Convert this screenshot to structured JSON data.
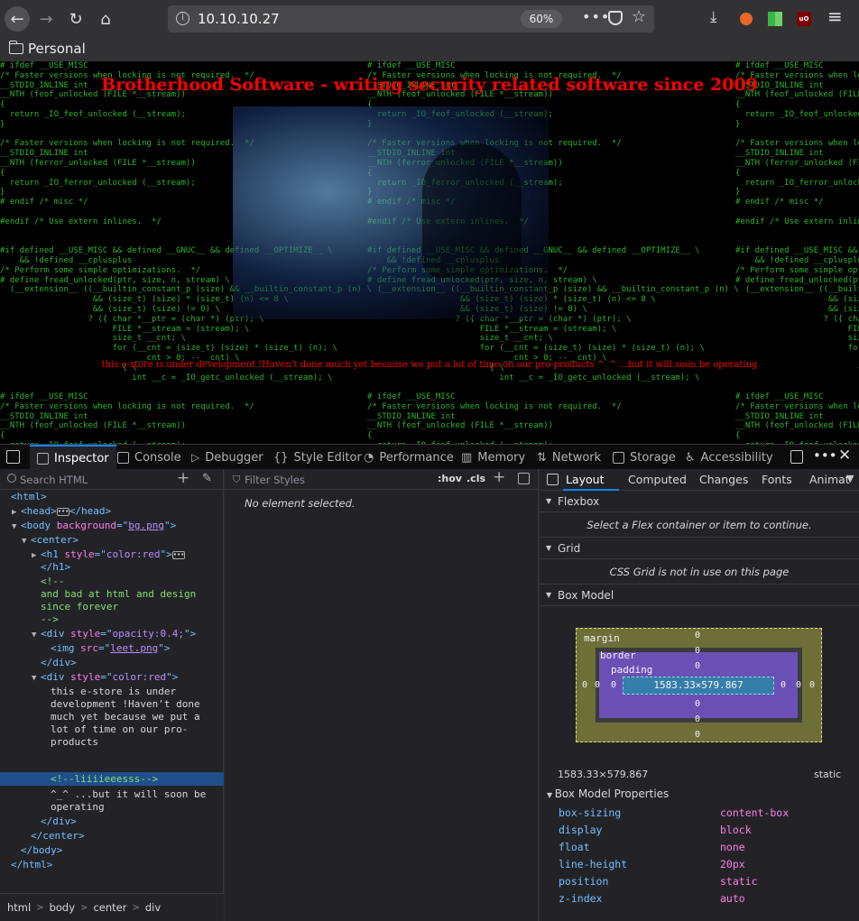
{
  "browser": {
    "url": "10.10.10.27",
    "zoom": "60%",
    "bookmark_folder": "Personal",
    "ext_badge": "uO"
  },
  "page": {
    "heading": "Brotherhood Software - writing security related software since 2009",
    "message": "this e-store is under development !Haven't done much yet because we put a lot of time on our pro-products ^_^ ...but it will soon be operating",
    "code_lines": [
      "# ifdef __USE_MISC",
      "/* Faster versions when locking is not required.  */",
      "__STDIO_INLINE int",
      "__NTH (feof_unlocked (FILE *__stream))",
      "{",
      "  return _IO_feof_unlocked (__stream);",
      "}",
      "",
      "/* Faster versions when locking is not required.  */",
      "__STDIO_INLINE int",
      "__NTH (ferror_unlocked (FILE *__stream))",
      "{",
      "  return _IO_ferror_unlocked (__stream);",
      "}",
      "# endif /* misc */",
      "",
      "#endif /* Use extern inlines.  */",
      "",
      "",
      "#if defined __USE_MISC && defined __GNUC__ && defined __OPTIMIZE__ \\",
      "    && !defined __cplusplus",
      "/* Perform some simple optimizations.  */",
      "# define fread_unlocked(ptr, size, n, stream) \\",
      "  (__extension__ ((__builtin_constant_p (size) && __builtin_constant_p (n) \\",
      "                   && (size_t) (size) * (size_t) (n) <= 8 \\",
      "                   && (size_t) (size) != 0) \\",
      "                  ? ({ char *__ptr = (char *) (ptr); \\",
      "                       FILE *__stream = (stream); \\",
      "                       size_t __cnt; \\",
      "                       for (__cnt = (size_t) (size) * (size_t) (n); \\",
      "                            __cnt > 0; --__cnt) \\",
      "                         { \\",
      "                           int __c = _IO_getc_unlocked (__stream); \\",
      "",
      "# ifdef __USE_MISC",
      "/* Faster versions when locking is not required.  */",
      "__STDIO_INLINE int",
      "__NTH (feof_unlocked (FILE *__stream))",
      "{",
      "  return _IO_feof_unlocked (__stream);"
    ]
  },
  "devtools": {
    "tabs": [
      "Inspector",
      "Console",
      "Debugger",
      "Style Editor",
      "Performance",
      "Memory",
      "Network",
      "Storage",
      "Accessibility"
    ],
    "search_placeholder": "Search HTML",
    "filter_placeholder": "Filter Styles",
    "hov": ":hov",
    "cls": ".cls",
    "no_element": "No element selected.",
    "markup": {
      "html_open": "<html>",
      "head_open": "<head>",
      "head_close": "</head>",
      "body_open": "<body ",
      "body_attr": "background",
      "body_val": "bg.png",
      "center_open": "<center>",
      "h1_open": "<h1 ",
      "h1_attr": "style",
      "h1_val": "color:red",
      "h1_close": "</h1>",
      "comment1_l1": "<!--",
      "comment1_l2": "and bad at html and design",
      "comment1_l3": "since forever",
      "comment1_l4": "-->",
      "div1_open": "<div ",
      "div1_attr": "style",
      "div1_val": "opacity:0.4;",
      "img_open": "<img ",
      "img_attr": "src",
      "img_val": "leet.png",
      "div_close": "</div>",
      "div2_open": "<div ",
      "div2_attr": "style",
      "div2_val": "color:red",
      "text_l1": "this e-store is under",
      "text_l2": "development !Haven't done",
      "text_l3": "much yet because we put a",
      "text_l4": "lot of time on our pro-",
      "text_l5": "products",
      "comment2": "<!--liiiieeesss-->",
      "text2_l1": "^_^ ...but it will soon be",
      "text2_l2": "operating",
      "center_close": "</center>",
      "body_close": "</body>",
      "html_close": "</html>"
    },
    "breadcrumb": [
      "html",
      "body",
      "center",
      "div"
    ],
    "side_tabs": [
      "Layout",
      "Computed",
      "Changes",
      "Fonts",
      "Animat"
    ],
    "flexbox": {
      "title": "Flexbox",
      "msg": "Select a Flex container or item to continue."
    },
    "grid": {
      "title": "Grid",
      "msg": "CSS Grid is not in use on this page"
    },
    "box_model": {
      "title": "Box Model",
      "margin_label": "margin",
      "border_label": "border",
      "padding_label": "padding",
      "content": "1583.33×579.867",
      "zero": "0",
      "dims": "1583.33×579.867",
      "position": "static"
    },
    "box_model_props": {
      "title": "Box Model Properties",
      "rows": [
        {
          "name": "box-sizing",
          "value": "content-box"
        },
        {
          "name": "display",
          "value": "block"
        },
        {
          "name": "float",
          "value": "none"
        },
        {
          "name": "line-height",
          "value": "20px"
        },
        {
          "name": "position",
          "value": "static"
        },
        {
          "name": "z-index",
          "value": "auto"
        }
      ]
    }
  }
}
